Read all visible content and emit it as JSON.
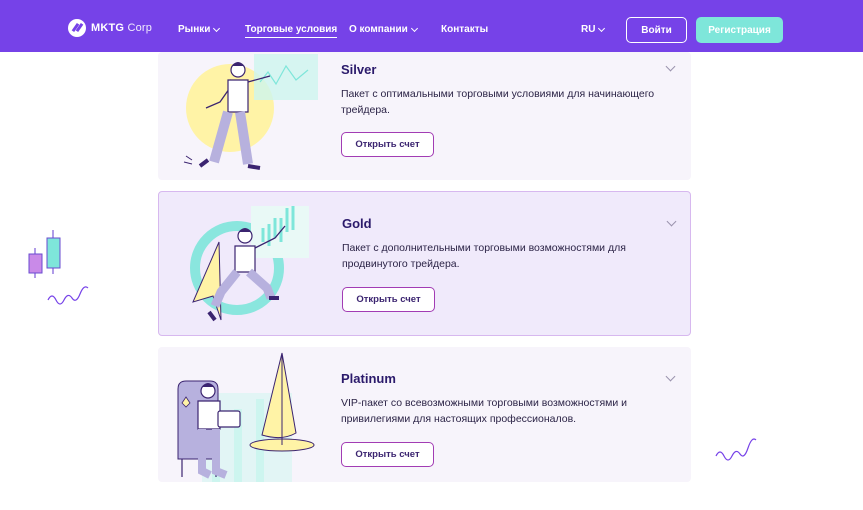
{
  "header": {
    "logo": {
      "brand": "MKTG",
      "suffix": "Corp"
    },
    "nav": [
      {
        "label": "Рынки",
        "dropdown": true
      },
      {
        "label": "Торговые условия",
        "dropdown": false,
        "active": true
      },
      {
        "label": "О компании",
        "dropdown": true
      },
      {
        "label": "Контакты",
        "dropdown": false
      }
    ],
    "lang": "RU",
    "login_label": "Войти",
    "register_label": "Регистрация"
  },
  "cards": [
    {
      "title": "Silver",
      "description": "Пакет с оптимальными торговыми условиями для начинающего трейдера.",
      "button": "Открыть счет"
    },
    {
      "title": "Gold",
      "description": "Пакет с дополнительными торговыми возможностями для продвинутого трейдера.",
      "button": "Открыть счет",
      "active": true
    },
    {
      "title": "Platinum",
      "description": "VIP-пакет со всевозможными торговыми возможностями и привилегиями для настоящих профессионалов.",
      "button": "Открыть счет"
    }
  ],
  "colors": {
    "header_bg": "#7642e8",
    "register_bg": "#7ee6da",
    "card_bg": "#f7f4fb",
    "active_card_bg": "#f0eafb",
    "button_border": "#a23cb4"
  }
}
